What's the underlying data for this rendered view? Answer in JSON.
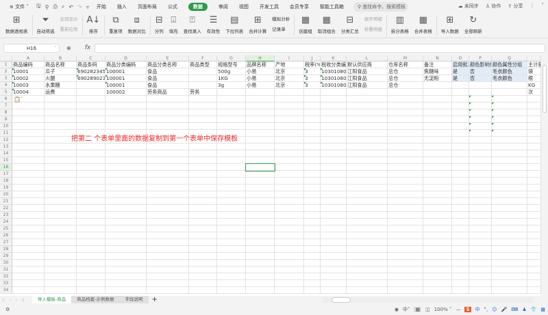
{
  "menubar": {
    "file": "文件",
    "tabs": [
      "开始",
      "插入",
      "页面布局",
      "公式",
      "数据",
      "审阅",
      "视图",
      "开发工具",
      "会员专享",
      "智能工具箱"
    ],
    "active_tab": "数据",
    "search_placeholder": "查找命令、搜索模板",
    "sync": "未同步",
    "collab": "协作",
    "share": "分享"
  },
  "ribbon": {
    "pivot": "数据透视表",
    "autofilter": "自动筛选",
    "show_all": "全部显示",
    "reapply": "重新应用",
    "sort": "排序",
    "duplicates": "重复项",
    "compare": "数据对比",
    "split_col": "分列",
    "fill": "填充",
    "lookup_entry": "查找录入",
    "validity": "有效性",
    "dropdown": "下拉列表",
    "consolidate": "合并计算",
    "whatif": "模拟分析",
    "record": "记录单",
    "group": "创建组",
    "ungroup": "取消组合",
    "subtotal": "分类汇总",
    "expand": "展开明细",
    "collapse": "折叠明细",
    "split_table": "拆分表格",
    "merge_table": "合并表格",
    "import": "导入数据",
    "refresh_all": "全部刷新"
  },
  "formula_bar": {
    "name_box": "H16",
    "fx": "fx",
    "value": ""
  },
  "sheet": {
    "columns": [
      "A",
      "B",
      "C",
      "D",
      "E",
      "F",
      "G",
      "H",
      "I",
      "J",
      "K",
      "L",
      "M",
      "N",
      "O",
      "P",
      "Q",
      ""
    ],
    "selected_cell": "H16",
    "rows": [
      [
        "商品编码",
        "商品名称",
        "商品条码",
        "商品分类编码",
        "商品分类名称",
        "商品类型",
        "规格型号",
        "品牌名称",
        "产地",
        "税率(%)",
        "税收分类编码",
        "默认供应商",
        "仓库名称",
        "备注",
        "启用批次",
        "颜色影响价格",
        "颜色属性分组",
        "主计量单位"
      ],
      [
        "10001",
        "瓜子",
        "690282345",
        "100001",
        "食品",
        "",
        "500g",
        "小易",
        "北京",
        "3",
        "10301080",
        "江阳食品",
        "总仓",
        "焦糖味",
        "是",
        "否",
        "毛衣颜色",
        "袋"
      ],
      [
        "10002",
        "火腿",
        "690289023",
        "100001",
        "食品",
        "",
        "1KG",
        "小易",
        "北京",
        "3",
        "10301080",
        "江阳食品",
        "总仓",
        "无淀粉",
        "是",
        "否",
        "毛衣颜色",
        "根"
      ],
      [
        "10003",
        "水果糖",
        "",
        "100001",
        "食品",
        "",
        "3g",
        "小易",
        "北京",
        "3",
        "10301080",
        "江阳食品",
        "总仓",
        "",
        "",
        "",
        "",
        "KG"
      ],
      [
        "10004",
        "运费",
        "",
        "100002",
        "劳务商品",
        "劳务",
        "",
        "",
        "",
        "",
        "",
        "",
        "",
        "",
        "",
        "",
        "",
        "次"
      ]
    ],
    "row_count": 34,
    "annotation": "把第二 个表单里面的数据复制到第一个表单中保存模板"
  },
  "sheet_tabs": [
    "导入模板-商品",
    "商品档案-示例数据",
    "字段说明"
  ],
  "active_sheet": "导入模板-商品",
  "status": {
    "zoom": "100%",
    "ime": "中"
  },
  "colors": {
    "accent": "#2f9a4a",
    "annotation": "#f02a2a",
    "selection": "#e1ecf7"
  }
}
